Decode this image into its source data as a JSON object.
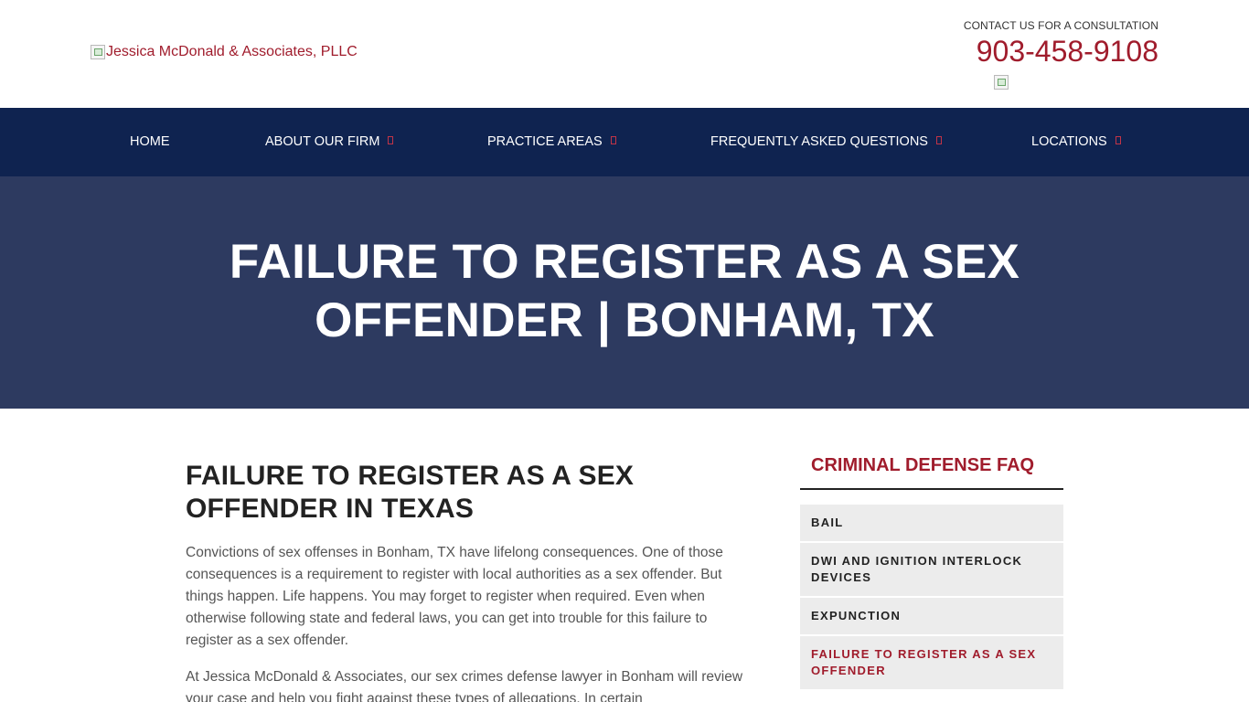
{
  "header": {
    "logo_alt": "Jessica McDonald & Associates, PLLC",
    "contact_label": "CONTACT US FOR A CONSULTATION",
    "phone": "903-458-9108"
  },
  "nav": {
    "items": [
      {
        "label": "HOME",
        "has_caret": false
      },
      {
        "label": "ABOUT OUR FIRM",
        "has_caret": true
      },
      {
        "label": "PRACTICE AREAS",
        "has_caret": true
      },
      {
        "label": "FREQUENTLY ASKED QUESTIONS",
        "has_caret": true
      },
      {
        "label": "LOCATIONS",
        "has_caret": true
      }
    ]
  },
  "hero": {
    "title_line1": "FAILURE TO REGISTER AS A SEX",
    "title_line2": "OFFENDER | BONHAM, TX"
  },
  "main": {
    "title_line1": "FAILURE TO REGISTER AS A SEX",
    "title_line2": "OFFENDER IN TEXAS",
    "paragraphs": [
      "Convictions of sex offenses in Bonham, TX have lifelong consequences. One of those consequences is a requirement to register with local authorities as a sex offender. But things happen. Life happens. You may forget to register when required. Even when otherwise following state and federal laws, you can get into trouble for this failure to register as a sex offender.",
      "At Jessica McDonald & Associates, our sex crimes defense lawyer in Bonham will review your case and help you fight against these types of allegations. In certain"
    ]
  },
  "sidebar": {
    "title": "CRIMINAL DEFENSE FAQ",
    "items": [
      {
        "label": "BAIL",
        "active": false
      },
      {
        "label": "DWI AND IGNITION INTERLOCK DEVICES",
        "active": false
      },
      {
        "label": "EXPUNCTION",
        "active": false
      },
      {
        "label": "FAILURE TO REGISTER AS A SEX OFFENDER",
        "active": true
      }
    ]
  },
  "colors": {
    "brand_red": "#a01c2c",
    "nav_bg": "#0f2350",
    "hero_bg": "#2d3a60",
    "sidebar_item_bg": "#ececec"
  }
}
